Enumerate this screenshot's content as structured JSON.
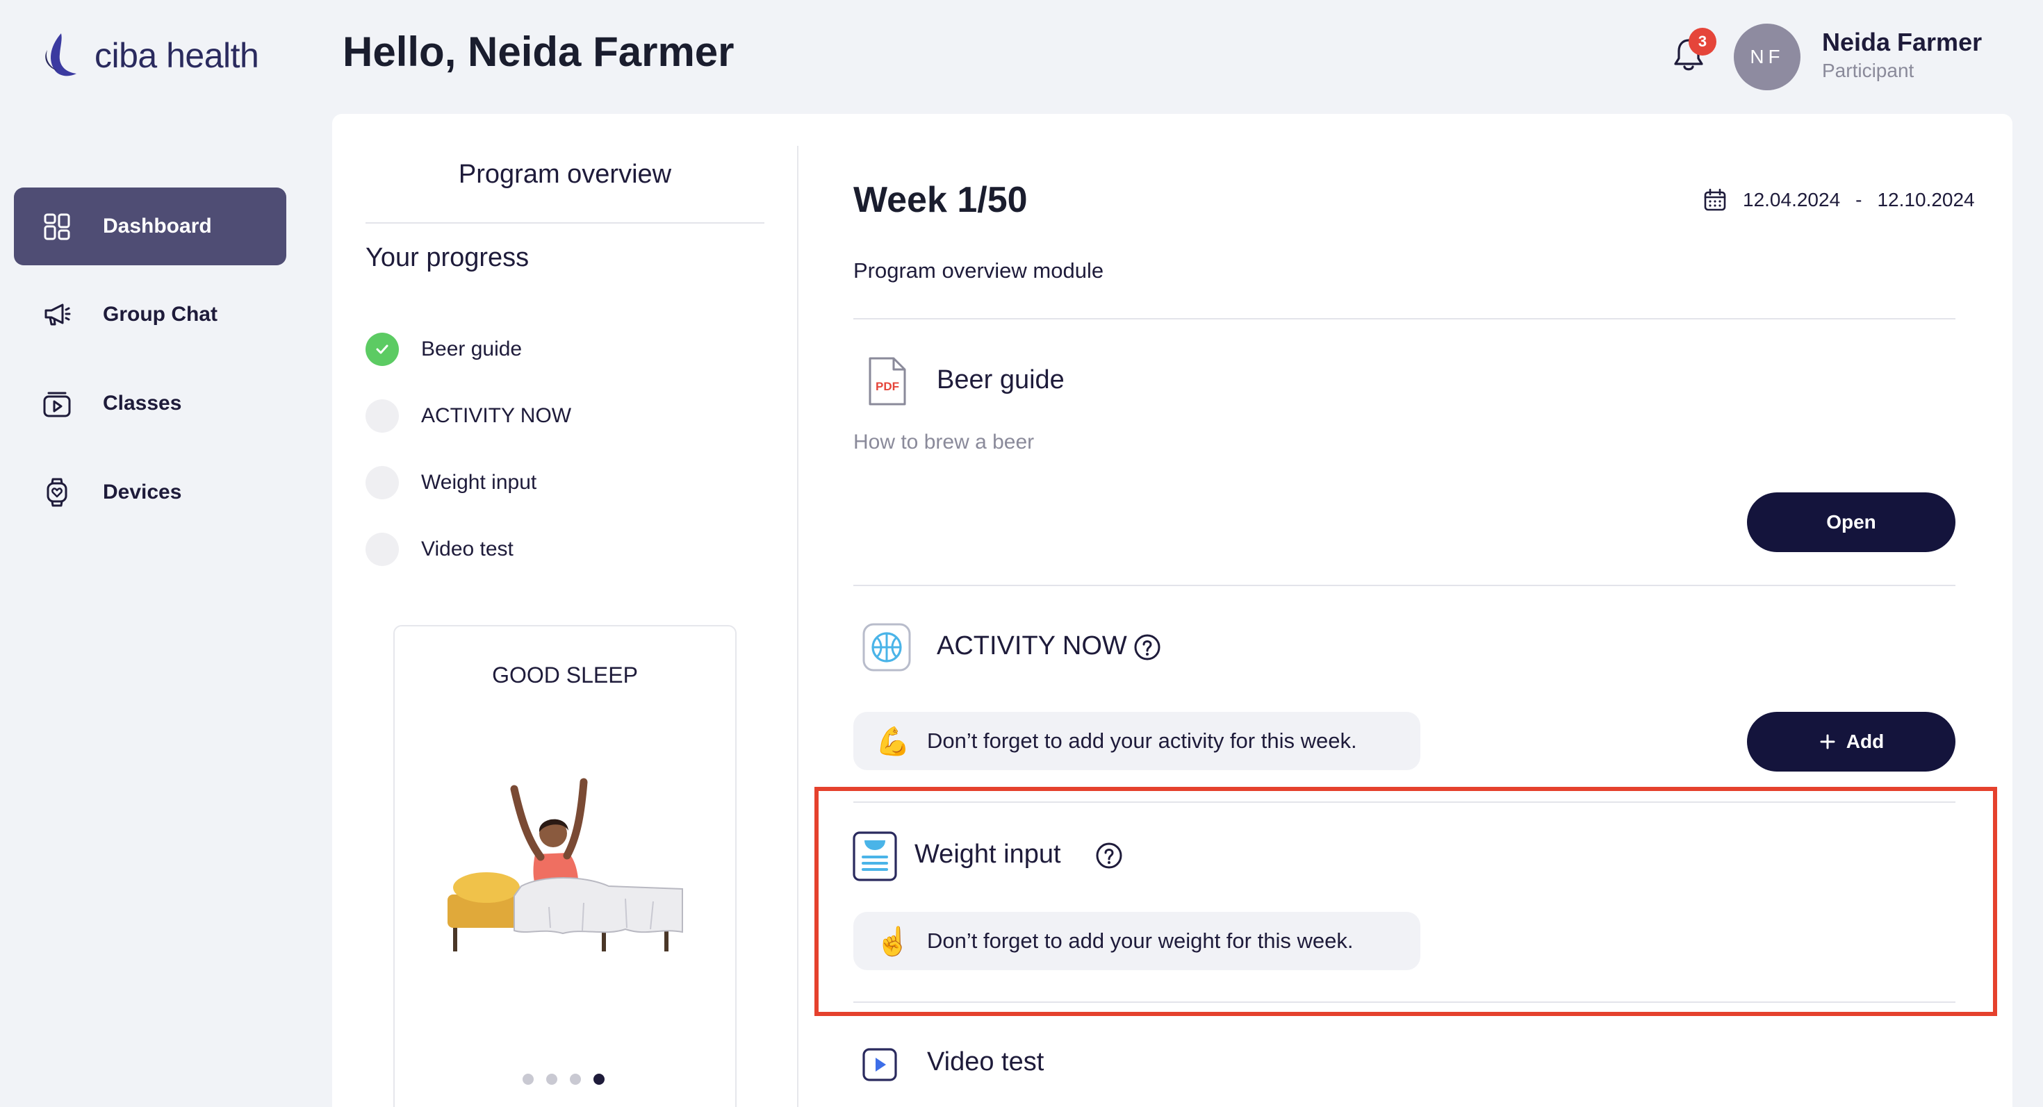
{
  "brand": {
    "name": "ciba health"
  },
  "header": {
    "greeting": "Hello, Neida Farmer",
    "notification_count": "3",
    "avatar_initials": "NF",
    "user_name": "Neida Farmer",
    "user_role": "Participant"
  },
  "sidebar": {
    "items": [
      {
        "label": "Dashboard",
        "icon": "dashboard-icon",
        "active": true
      },
      {
        "label": "Group Chat",
        "icon": "megaphone-icon",
        "active": false
      },
      {
        "label": "Classes",
        "icon": "play-folder-icon",
        "active": false
      },
      {
        "label": "Devices",
        "icon": "watch-icon",
        "active": false
      }
    ]
  },
  "overview": {
    "title": "Program overview",
    "progress_title": "Your progress",
    "items": [
      {
        "label": "Beer guide",
        "done": true
      },
      {
        "label": "ACTIVITY NOW",
        "done": false
      },
      {
        "label": "Weight input",
        "done": false
      },
      {
        "label": "Video test",
        "done": false
      }
    ],
    "carousel": {
      "title": "GOOD SLEEP",
      "slides": 4,
      "active_slide": 4
    }
  },
  "week": {
    "title": "Week 1/50",
    "date_start": "12.04.2024",
    "date_sep": "-",
    "date_end": "12.10.2024",
    "module_label": "Program overview module"
  },
  "sections": {
    "beer_guide": {
      "title": "Beer guide",
      "subtitle": "How to brew a beer",
      "button": "Open",
      "icon": "pdf-file-icon"
    },
    "activity": {
      "title": "ACTIVITY NOW",
      "reminder": "Don’t forget to add your activity for this week.",
      "reminder_emoji": "💪",
      "button": "Add",
      "icon": "basketball-icon"
    },
    "weight": {
      "title": "Weight input",
      "reminder": "Don’t forget to add your weight for this week.",
      "reminder_emoji": "☝️",
      "icon": "scale-icon"
    },
    "video": {
      "title": "Video test",
      "icon": "video-play-icon"
    }
  },
  "colors": {
    "primary_dark": "#14143c",
    "sidebar_active": "#4f4d74",
    "success": "#5ccb63",
    "badge": "#e5453a",
    "highlight": "#e5412d"
  }
}
